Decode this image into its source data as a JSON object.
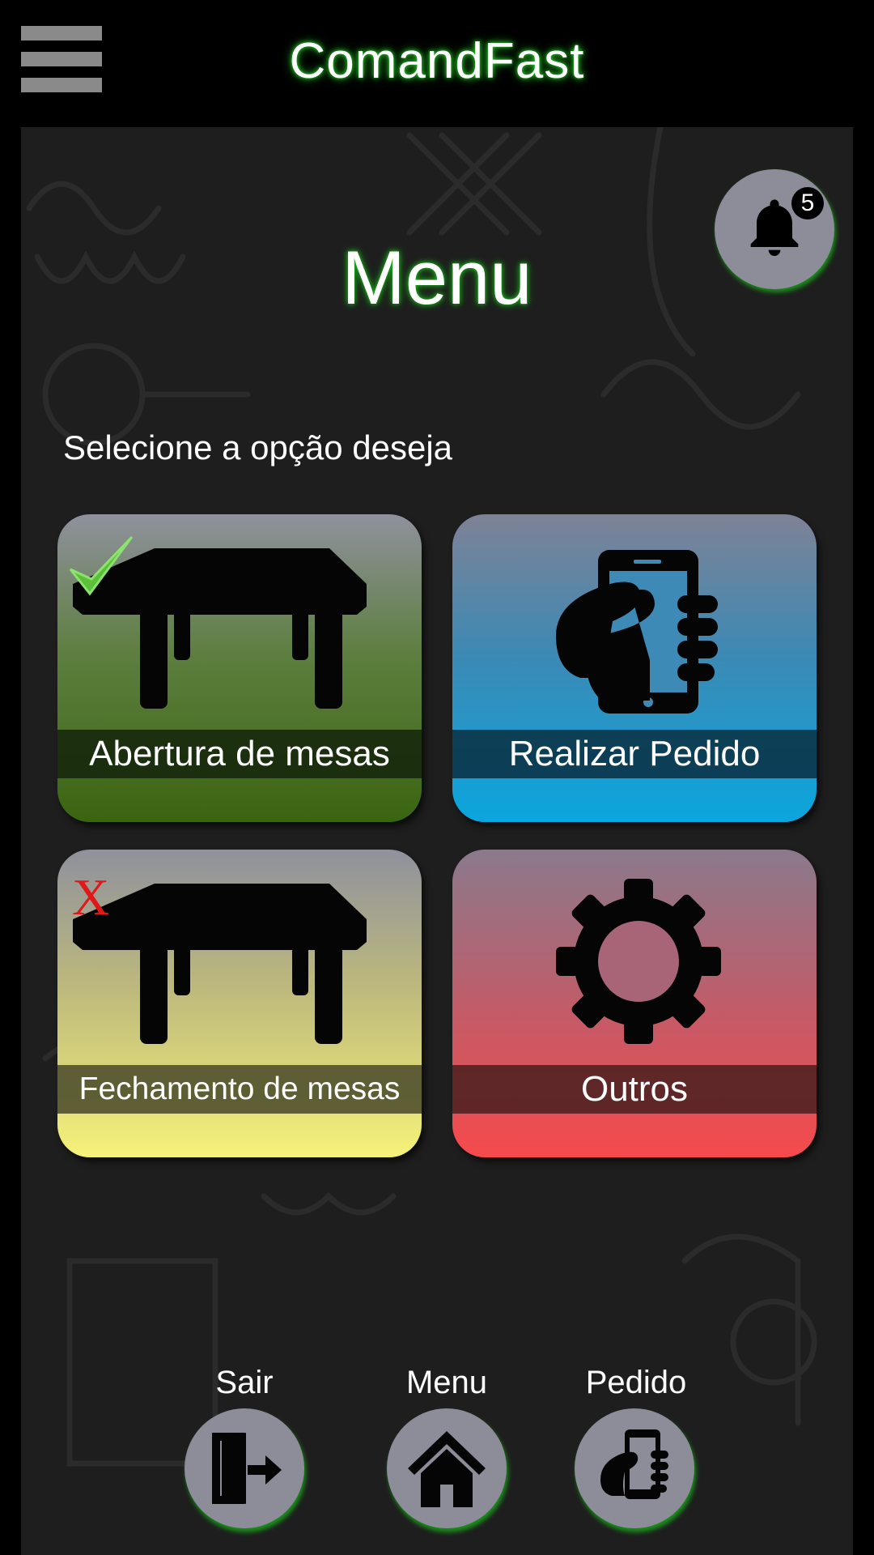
{
  "header": {
    "title": "ComandFast",
    "menu_icon": "hamburger-icon"
  },
  "notifications": {
    "count": "5",
    "icon": "bell-icon"
  },
  "page": {
    "title": "Menu",
    "subtitle": "Selecione a opção deseja"
  },
  "tiles": [
    {
      "label": "Abertura de mesas",
      "icon": "table-icon",
      "status_icon": "checkmark-icon"
    },
    {
      "label": "Realizar Pedido",
      "icon": "hand-phone-icon"
    },
    {
      "label": "Fechamento de mesas",
      "icon": "table-icon",
      "status_icon": "x-mark-icon",
      "status_text": "X"
    },
    {
      "label": "Outros",
      "icon": "gear-icon"
    }
  ],
  "bottom_nav": [
    {
      "label": "Sair",
      "icon": "exit-door-icon"
    },
    {
      "label": "Menu",
      "icon": "home-icon"
    },
    {
      "label": "Pedido",
      "icon": "hand-phone-icon"
    }
  ],
  "colors": {
    "glow": "#1fb51f",
    "abertura": "#3a6510",
    "pedido": "#0aa6de",
    "fechamento": "#f6f279",
    "outros": "#f64a4c"
  }
}
